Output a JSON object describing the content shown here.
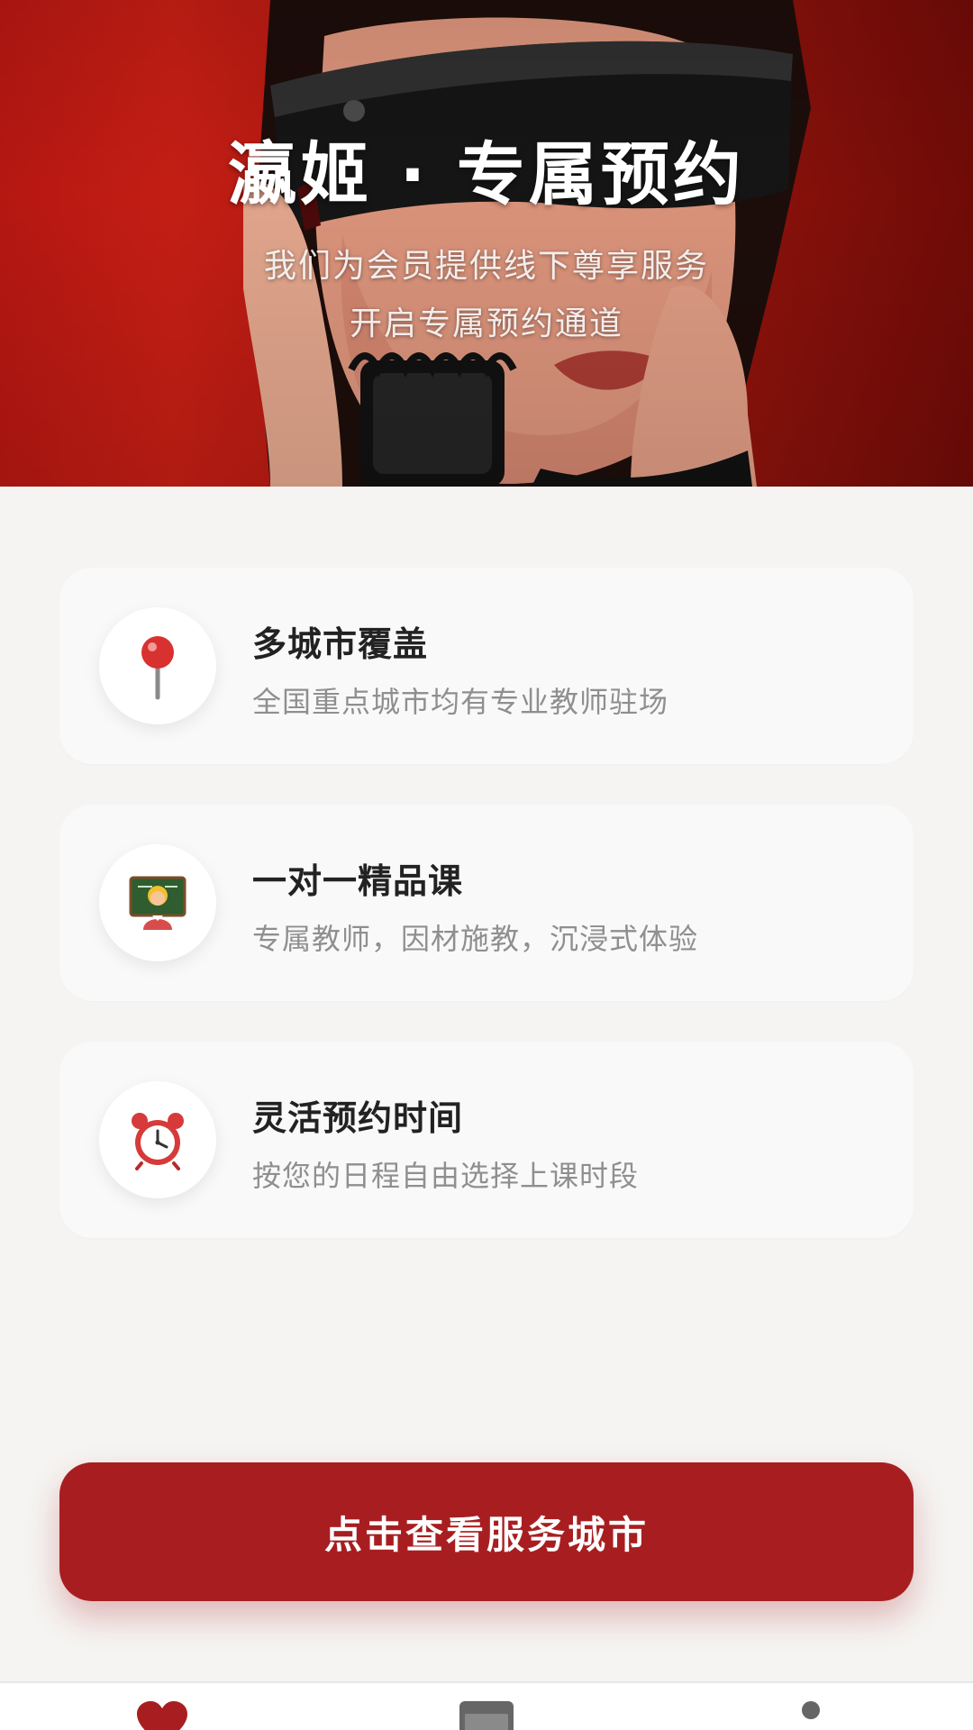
{
  "hero": {
    "title": "瀛姬 · 专属预约",
    "subtitle_line1": "我们为会员提供线下尊享服务",
    "subtitle_line2": "开启专属预约通道"
  },
  "features": [
    {
      "icon": "pin-icon",
      "title": "多城市覆盖",
      "description": "全国重点城市均有专业教师驻场"
    },
    {
      "icon": "teacher-icon",
      "title": "一对一精品课",
      "description": "专属教师，因材施教，沉浸式体验"
    },
    {
      "icon": "alarm-clock-icon",
      "title": "灵活预约时间",
      "description": "按您的日程自由选择上课时段"
    }
  ],
  "cta": {
    "label": "点击查看服务城市"
  },
  "tabbar": {
    "tabs": [
      {
        "icon": "heart-icon",
        "active": true
      },
      {
        "icon": "calendar-icon",
        "active": false
      },
      {
        "icon": "profile-icon",
        "active": false
      }
    ]
  },
  "colors": {
    "brand": "#a81e20",
    "hero_red": "#b51712",
    "background": "#f5f4f2",
    "card": "#f9f9f9",
    "title_text": "#222222",
    "desc_text": "#8f8f8f"
  }
}
